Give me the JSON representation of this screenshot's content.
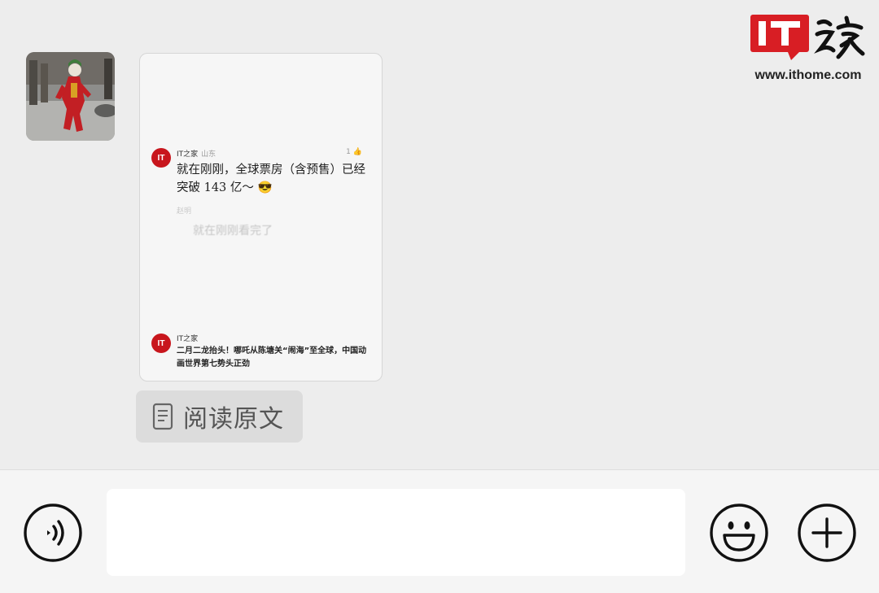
{
  "watermark": {
    "logo_text": "IT",
    "brush_text": "之家",
    "url": "www.ithome.com"
  },
  "chat": {
    "avatar_icon": "avatar-image",
    "card": {
      "badge_text": "IT",
      "post": {
        "author": "IT之家",
        "location": "山东",
        "likes": "1",
        "text": "就在刚刚，全球票房（含预售）已经突破 143 亿～ 😎",
        "reply_author": "赵明",
        "reply_text": "就在刚刚看完了"
      },
      "news": {
        "source": "IT之家",
        "title": "二月二龙抬头！哪吒从陈塘关“闹海”至全球，中国动画世界第七势头正劲"
      }
    },
    "read_original_label": "阅读原文"
  },
  "input_bar": {
    "voice_icon": "voice-icon",
    "input_value": "",
    "emoji_icon": "emoji-icon",
    "plus_icon": "plus-icon"
  },
  "colors": {
    "brand_red": "#c8161d",
    "background": "#ededed",
    "bar": "#f5f5f5"
  }
}
